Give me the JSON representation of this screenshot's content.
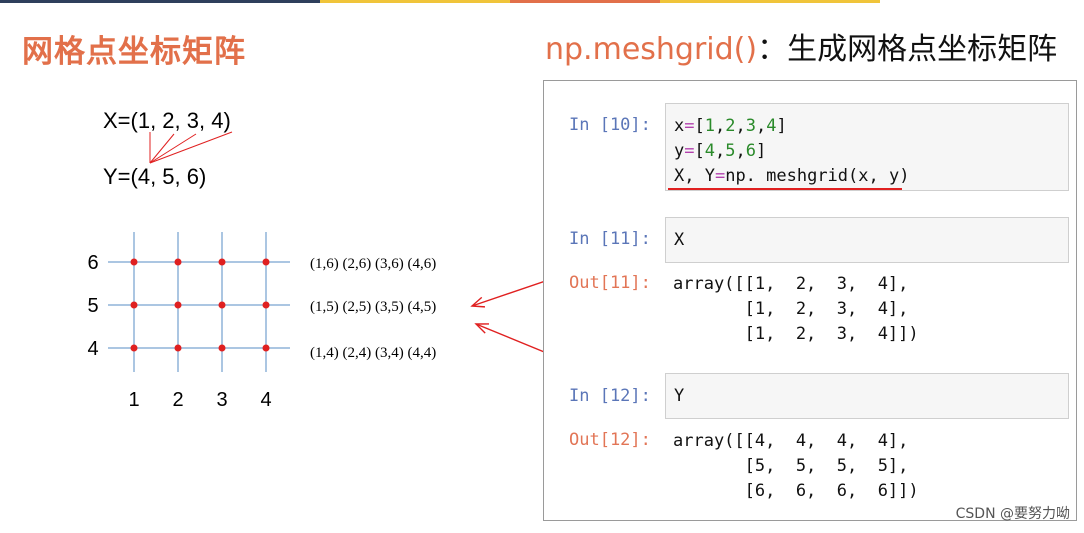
{
  "header": {
    "left_title": "网格点坐标矩阵",
    "right_title_fn": "np.meshgrid()",
    "right_title_desc": "：生成网格点坐标矩阵"
  },
  "vectors": {
    "x_line": "X=(1, 2, 3, 4)",
    "y_line": "Y=(4, 5, 6)"
  },
  "grid": {
    "x_ticks": [
      "1",
      "2",
      "3",
      "4"
    ],
    "y_ticks": [
      "6",
      "5",
      "4"
    ],
    "coord_rows": [
      "(1,6) (2,6) (3,6) (4,6)",
      "(1,5) (2,5) (3,5) (4,5)",
      "(1,4) (2,4) (3,4) (4,4)"
    ]
  },
  "notebook": {
    "cell1": {
      "prompt": "In [10]:",
      "line1": [
        "x",
        "=",
        "[",
        "1",
        ",",
        "2",
        ",",
        "3",
        ",",
        "4",
        "]"
      ],
      "line2": [
        "y",
        "=",
        "[",
        "4",
        ",",
        "5",
        ",",
        "6",
        "]"
      ],
      "line3_a": "X, Y",
      "line3_op": "=",
      "line3_b": "np. meshgrid(x, y)"
    },
    "cell2": {
      "prompt": "In [11]:",
      "code": "X",
      "out_prompt": "Out[11]:",
      "out_lines": [
        "array([[1,  2,  3,  4],",
        "       [1,  2,  3,  4],",
        "       [1,  2,  3,  4]])"
      ]
    },
    "cell3": {
      "prompt": "In [12]:",
      "code": "Y",
      "out_prompt": "Out[12]:",
      "out_lines": [
        "array([[4,  4,  4,  4],",
        "       [5,  5,  5,  5],",
        "       [6,  6,  6,  6]])"
      ]
    }
  },
  "watermark": "CSDN @要努力呦",
  "colors": {
    "accent": "#e2704a",
    "grid_line": "#8fb3d9",
    "point": "#e02020",
    "arrow": "#e02020",
    "prompt_in": "#5b76b8",
    "prompt_out": "#e27556"
  }
}
